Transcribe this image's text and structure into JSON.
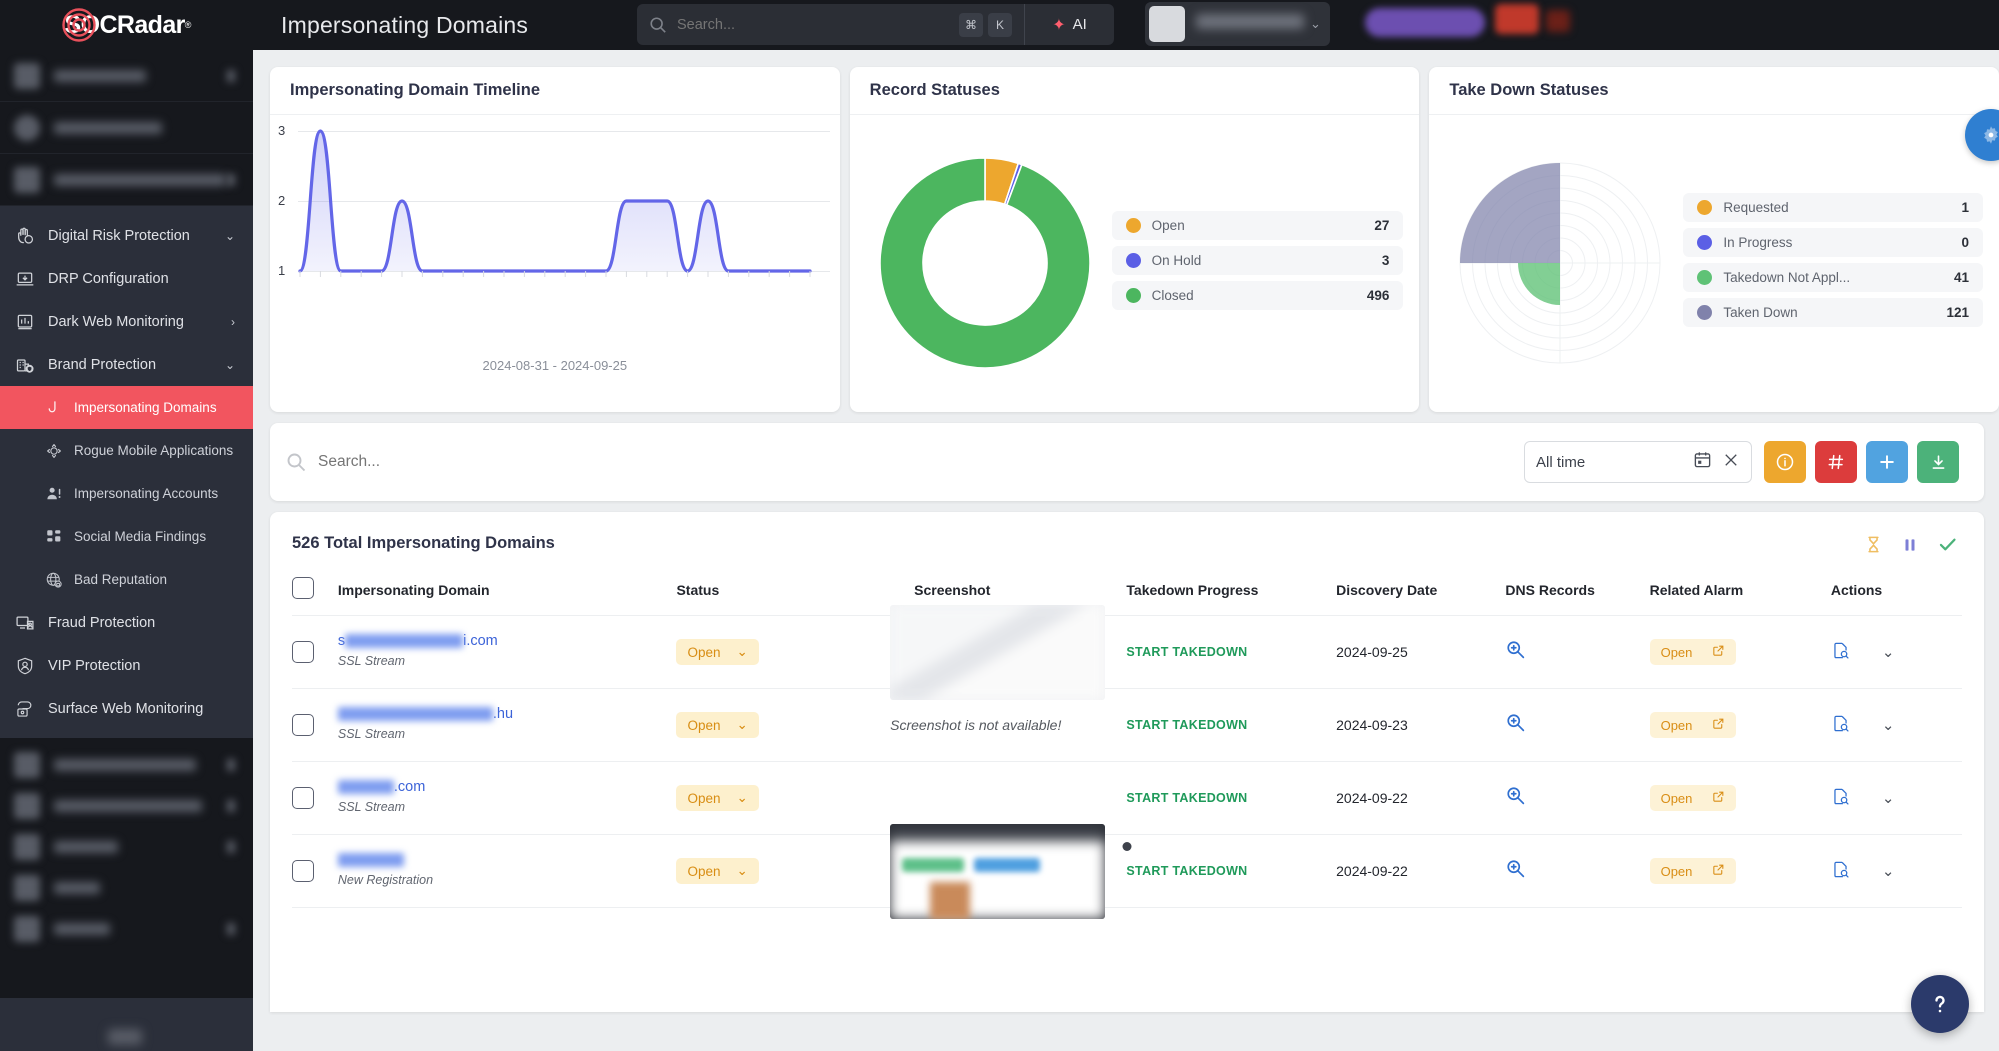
{
  "app": {
    "brand": "SOCRadar",
    "brand_reg": "®",
    "page_title": "Impersonating Domains"
  },
  "topbar": {
    "search_placeholder": "Search...",
    "kbd_cmd": "⌘",
    "kbd_key": "K",
    "ai_label": "AI",
    "ai_icon": "sparkle-icon"
  },
  "sidebar": {
    "items": [
      {
        "label": "Digital Risk Protection",
        "icon": "hand-shield-icon",
        "caret": "⌄",
        "active": false
      },
      {
        "label": "DRP Configuration",
        "icon": "laptop-config-icon",
        "active": false
      },
      {
        "label": "Dark Web Monitoring",
        "icon": "dark-web-icon",
        "caret": "›",
        "active": false
      },
      {
        "label": "Brand Protection",
        "icon": "brand-shield-icon",
        "caret": "⌄",
        "active": false
      }
    ],
    "sub_items": [
      {
        "label": "Impersonating Domains",
        "icon": "hook-icon",
        "active": true
      },
      {
        "label": "Rogue Mobile Applications",
        "icon": "bug-icon",
        "active": false
      },
      {
        "label": "Impersonating Accounts",
        "icon": "person-alert-icon",
        "active": false
      },
      {
        "label": "Social Media Findings",
        "icon": "grid-icon",
        "active": false
      },
      {
        "label": "Bad Reputation",
        "icon": "globe-lock-icon",
        "active": false
      }
    ],
    "tail_items": [
      {
        "label": "Fraud Protection",
        "icon": "monitor-fraud-icon"
      },
      {
        "label": "VIP Protection",
        "icon": "vip-shield-icon"
      },
      {
        "label": "Surface Web Monitoring",
        "icon": "surface-web-icon"
      }
    ]
  },
  "cards": {
    "timeline": {
      "title": "Impersonating Domain Timeline"
    },
    "record_statuses": {
      "title": "Record Statuses"
    },
    "takedown_statuses": {
      "title": "Take Down Statuses"
    }
  },
  "chart_data": [
    {
      "type": "area",
      "title": "Impersonating Domain Timeline",
      "xlabel": "2024-08-31 - 2024-09-25",
      "ylabel": "",
      "ylim": [
        1,
        3
      ],
      "yticks": [
        1,
        2,
        3
      ],
      "grid": true,
      "legend": "none",
      "series_color": "#6366e8",
      "x": [
        "2024-08-31",
        "2024-09-01",
        "2024-09-02",
        "2024-09-03",
        "2024-09-04",
        "2024-09-05",
        "2024-09-06",
        "2024-09-07",
        "2024-09-08",
        "2024-09-09",
        "2024-09-10",
        "2024-09-11",
        "2024-09-12",
        "2024-09-13",
        "2024-09-14",
        "2024-09-15",
        "2024-09-16",
        "2024-09-17",
        "2024-09-18",
        "2024-09-19",
        "2024-09-20",
        "2024-09-21",
        "2024-09-22",
        "2024-09-23",
        "2024-09-24",
        "2024-09-25"
      ],
      "values": [
        1,
        3,
        1,
        1,
        1,
        2,
        1,
        1,
        1,
        1,
        1,
        1,
        1,
        1,
        1,
        1,
        2,
        2,
        2,
        1,
        2,
        1,
        1,
        1,
        1,
        1
      ]
    },
    {
      "type": "pie",
      "title": "Record Statuses",
      "legend_position": "right",
      "labels": [
        "Open",
        "On Hold",
        "Closed"
      ],
      "values": [
        27,
        3,
        496
      ],
      "colors": [
        "#eda72e",
        "#5b5fe5",
        "#4cb65f"
      ]
    },
    {
      "type": "pie",
      "title": "Take Down Statuses",
      "subtype": "polar-area",
      "legend_position": "right",
      "labels": [
        "Requested",
        "In Progress",
        "Takedown Not Appl...",
        "Taken Down"
      ],
      "values": [
        1,
        0,
        41,
        121
      ],
      "colors": [
        "#eda72e",
        "#5b5fe5",
        "#5fc276",
        "#8082ab"
      ]
    }
  ],
  "filter_bar": {
    "search_placeholder": "Search...",
    "search_icon": "search-icon",
    "date_value": "All time",
    "calendar_icon": "calendar-icon",
    "clear_icon": "close-icon",
    "buttons": [
      {
        "name": "info-button",
        "icon": "info-circle-icon",
        "color": "#eda72e"
      },
      {
        "name": "hash-button",
        "icon": "hash-icon",
        "color": "#dc3c3c"
      },
      {
        "name": "add-button",
        "icon": "plus-icon",
        "color": "#51a3e0"
      },
      {
        "name": "download-button",
        "icon": "download-icon",
        "color": "#4cb27a"
      }
    ]
  },
  "table": {
    "title": "526 Total Impersonating Domains",
    "header_icons": [
      {
        "name": "hourglass-icon",
        "glyph": "⧗",
        "color": "#efbe62"
      },
      {
        "name": "pause-icon",
        "glyph": "❙❙",
        "color": "#7d7fd6"
      },
      {
        "name": "check-icon",
        "glyph": "✓",
        "color": "#4cb27a"
      }
    ],
    "columns": [
      "Impersonating Domain",
      "Status",
      "Screenshot",
      "Takedown Progress",
      "Discovery Date",
      "DNS Records",
      "Related Alarm",
      "Actions"
    ],
    "rows": [
      {
        "domain_redacted_width": 118,
        "domain_suffix": "i.com",
        "domain_prefix": "s",
        "source": "SSL Stream",
        "status": "Open",
        "screenshot": "thumbnail",
        "takedown": "START TAKEDOWN",
        "discovery_date": "2024-09-25",
        "dns_icon": "magnifier-plus-icon",
        "alarm": "Open",
        "actions_icon": "document-search-icon",
        "expand_icon": "chevron-down-icon"
      },
      {
        "domain_redacted_width": 155,
        "domain_suffix": ".hu",
        "domain_prefix": "",
        "source": "SSL Stream",
        "status": "Open",
        "screenshot": "Screenshot is not available!",
        "takedown": "START TAKEDOWN",
        "discovery_date": "2024-09-23",
        "dns_icon": "magnifier-plus-icon",
        "alarm": "Open",
        "actions_icon": "document-search-icon",
        "expand_icon": "chevron-down-icon"
      },
      {
        "domain_redacted_width": 56,
        "domain_suffix": ".com",
        "domain_prefix": "",
        "source": "SSL Stream",
        "status": "Open",
        "screenshot": "empty",
        "takedown": "START TAKEDOWN",
        "discovery_date": "2024-09-22",
        "dns_icon": "magnifier-plus-icon",
        "alarm": "Open",
        "actions_icon": "document-search-icon",
        "expand_icon": "chevron-down-icon"
      },
      {
        "domain_redacted_width": 66,
        "domain_suffix": "",
        "domain_prefix": "",
        "source": "New Registration",
        "status": "Open",
        "screenshot": "thumbnail",
        "takedown": "START TAKEDOWN",
        "discovery_date": "2024-09-22",
        "dns_icon": "magnifier-plus-icon",
        "alarm": "Open",
        "actions_icon": "document-search-icon",
        "expand_icon": "chevron-down-icon"
      }
    ]
  },
  "help": {
    "icon": "question-mark-icon",
    "color": "#2b3a6b"
  }
}
